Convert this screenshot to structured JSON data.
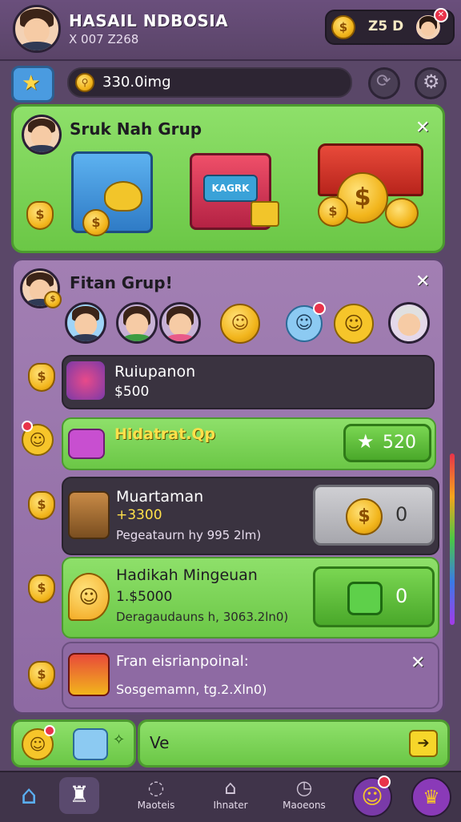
{
  "header": {
    "title": "HASAIL NDBOSIA",
    "subtitle": "X 007 Z268",
    "coin_count": "Z5 D",
    "coin_symbol": "$"
  },
  "search": {
    "value": "330.0img",
    "star_icon": "star-icon"
  },
  "card1": {
    "title": "Sruk Nah Grup",
    "box_label": "KAGRK",
    "coin_symbol": "$",
    "close": "✕"
  },
  "card2": {
    "title": "Fitan Grup!",
    "close": "✕",
    "rows": [
      {
        "line1": "Ruiupanon",
        "line2": "$500"
      },
      {
        "line1": "Hidatrat.Qp",
        "button": "520"
      },
      {
        "line1": "Muartaman",
        "line2": "+3300",
        "line3": "Pegeataurn hy 995 2lm)",
        "button": "0"
      },
      {
        "line1": "Hadikah Mingeuan",
        "line2": "1.$5000",
        "line3": "Deragaudauns h, 3063.2ln0)",
        "button": "0"
      },
      {
        "line1": "Fran eisrianpoinal:",
        "line3": "Sosgemamn, tg.2.Xln0)"
      }
    ]
  },
  "footer_input": {
    "value": "Ve"
  },
  "nav": {
    "items": [
      {
        "label": ""
      },
      {
        "label": ""
      },
      {
        "label": "Maoteis"
      },
      {
        "label": "Ihnater"
      },
      {
        "label": "Maoeons"
      },
      {
        "label": ""
      },
      {
        "label": ""
      }
    ]
  },
  "colors": {
    "accent_green": "#6bc746",
    "panel_purple": "#8e6aa3",
    "coin_gold": "#f2b51c",
    "badge_red": "#e8334a"
  }
}
